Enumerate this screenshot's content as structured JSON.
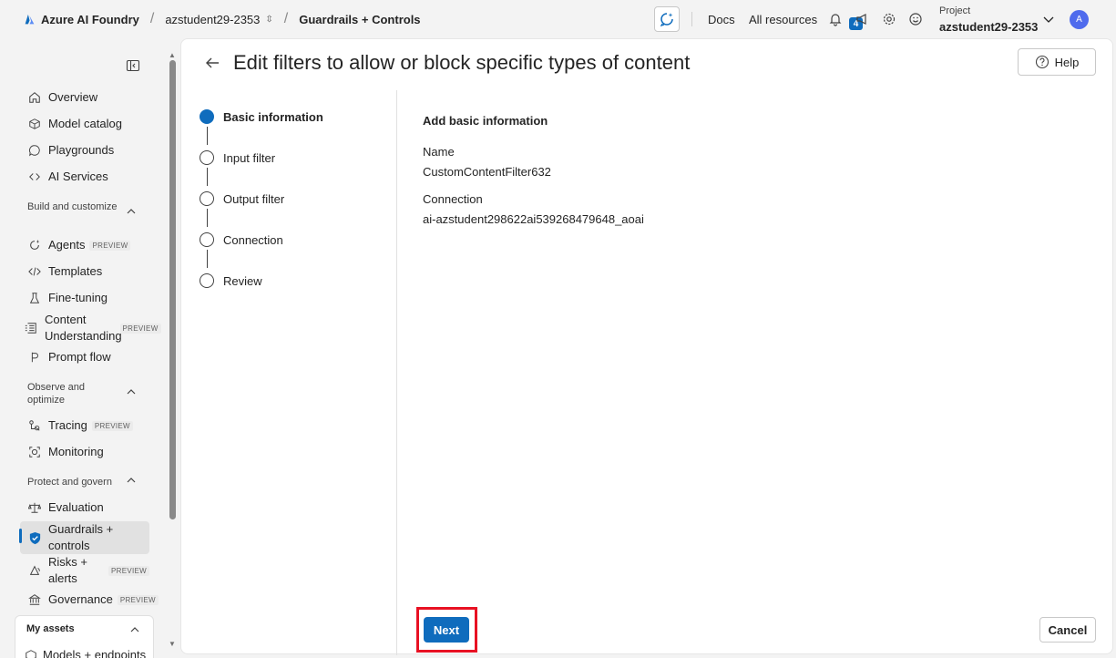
{
  "topbar": {
    "brand": "Azure AI Foundry",
    "project_crumb": "azstudent29-2353",
    "page_crumb": "Guardrails + Controls",
    "docs": "Docs",
    "all_resources": "All resources",
    "notification_count": "4",
    "project_label": "Project",
    "project_name": "azstudent29-2353",
    "avatar_initial": "A"
  },
  "sidebar": {
    "items": [
      {
        "label": "Overview",
        "icon": "home-icon"
      },
      {
        "label": "Model catalog",
        "icon": "cube-icon"
      },
      {
        "label": "Playgrounds",
        "icon": "chat-icon"
      },
      {
        "label": "AI Services",
        "icon": "link-icon"
      }
    ],
    "build_section": "Build and customize",
    "build_items": [
      {
        "label": "Agents",
        "preview": "PREVIEW"
      },
      {
        "label": "Templates"
      },
      {
        "label": "Fine-tuning"
      },
      {
        "label": "Content Understanding",
        "preview": "PREVIEW"
      },
      {
        "label": "Prompt flow"
      }
    ],
    "observe_section": "Observe and optimize",
    "observe_items": [
      {
        "label": "Tracing",
        "preview": "PREVIEW"
      },
      {
        "label": "Monitoring"
      }
    ],
    "protect_section": "Protect and govern",
    "protect_items": [
      {
        "label": "Evaluation"
      },
      {
        "label": "Guardrails + controls"
      },
      {
        "label": "Risks + alerts",
        "preview": "PREVIEW"
      },
      {
        "label": "Governance",
        "preview": "PREVIEW"
      }
    ],
    "assets_title": "My assets",
    "assets_item": "Models + endpoints"
  },
  "main": {
    "title": "Edit filters to allow or block specific types of content",
    "help": "Help",
    "steps": [
      "Basic information",
      "Input filter",
      "Output filter",
      "Connection",
      "Review"
    ],
    "form_title": "Add basic information",
    "name_label": "Name",
    "name_value": "CustomContentFilter632",
    "connection_label": "Connection",
    "connection_value": "ai-azstudent298622ai539268479648_aoai",
    "next": "Next",
    "cancel": "Cancel"
  },
  "colors": {
    "accent": "#0f6cbd",
    "highlight": "#e81123"
  }
}
